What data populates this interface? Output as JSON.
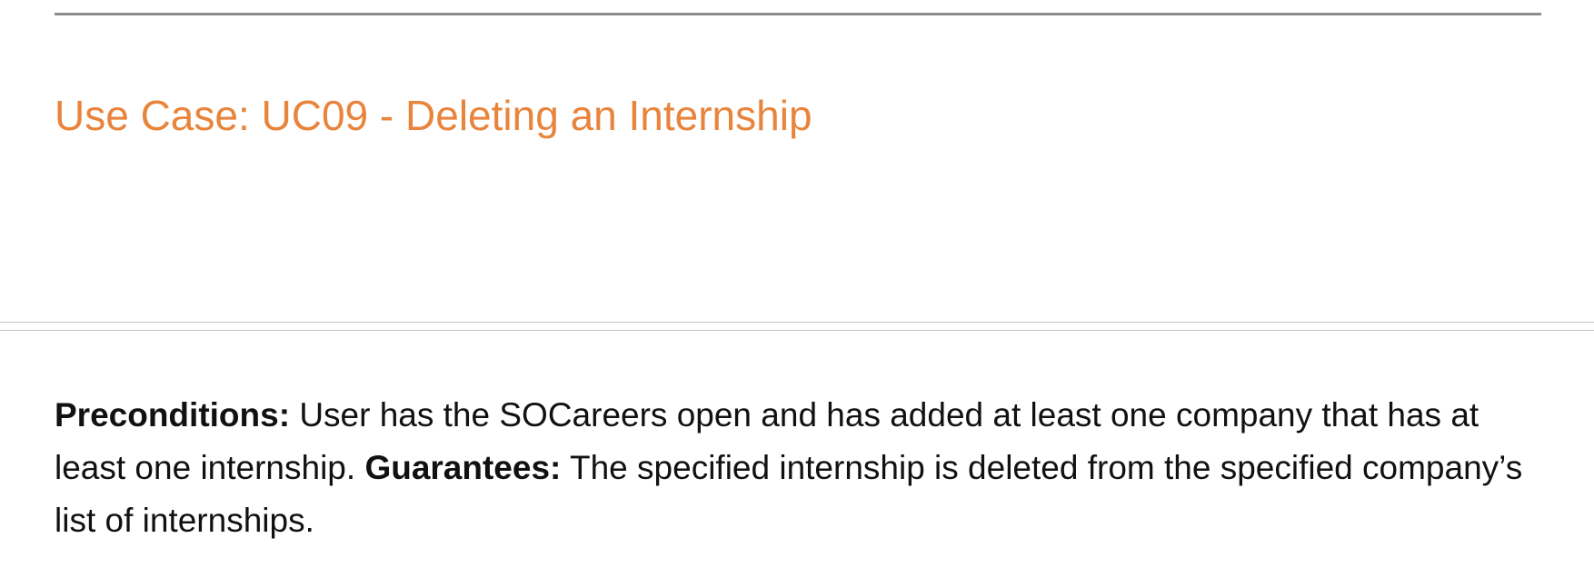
{
  "heading": "Use Case: UC09 - Deleting an Internship",
  "preconditions": {
    "label": "Preconditions:",
    "text": "User has the SOCareers open and has added at least one company that has at least one internship."
  },
  "guarantees": {
    "label": "Guarantees:",
    "text": "The specified internship is deleted from the specified company’s list of internships."
  },
  "colors": {
    "heading": "#e8843c",
    "text": "#111111",
    "rule": "#8c8c8c"
  }
}
